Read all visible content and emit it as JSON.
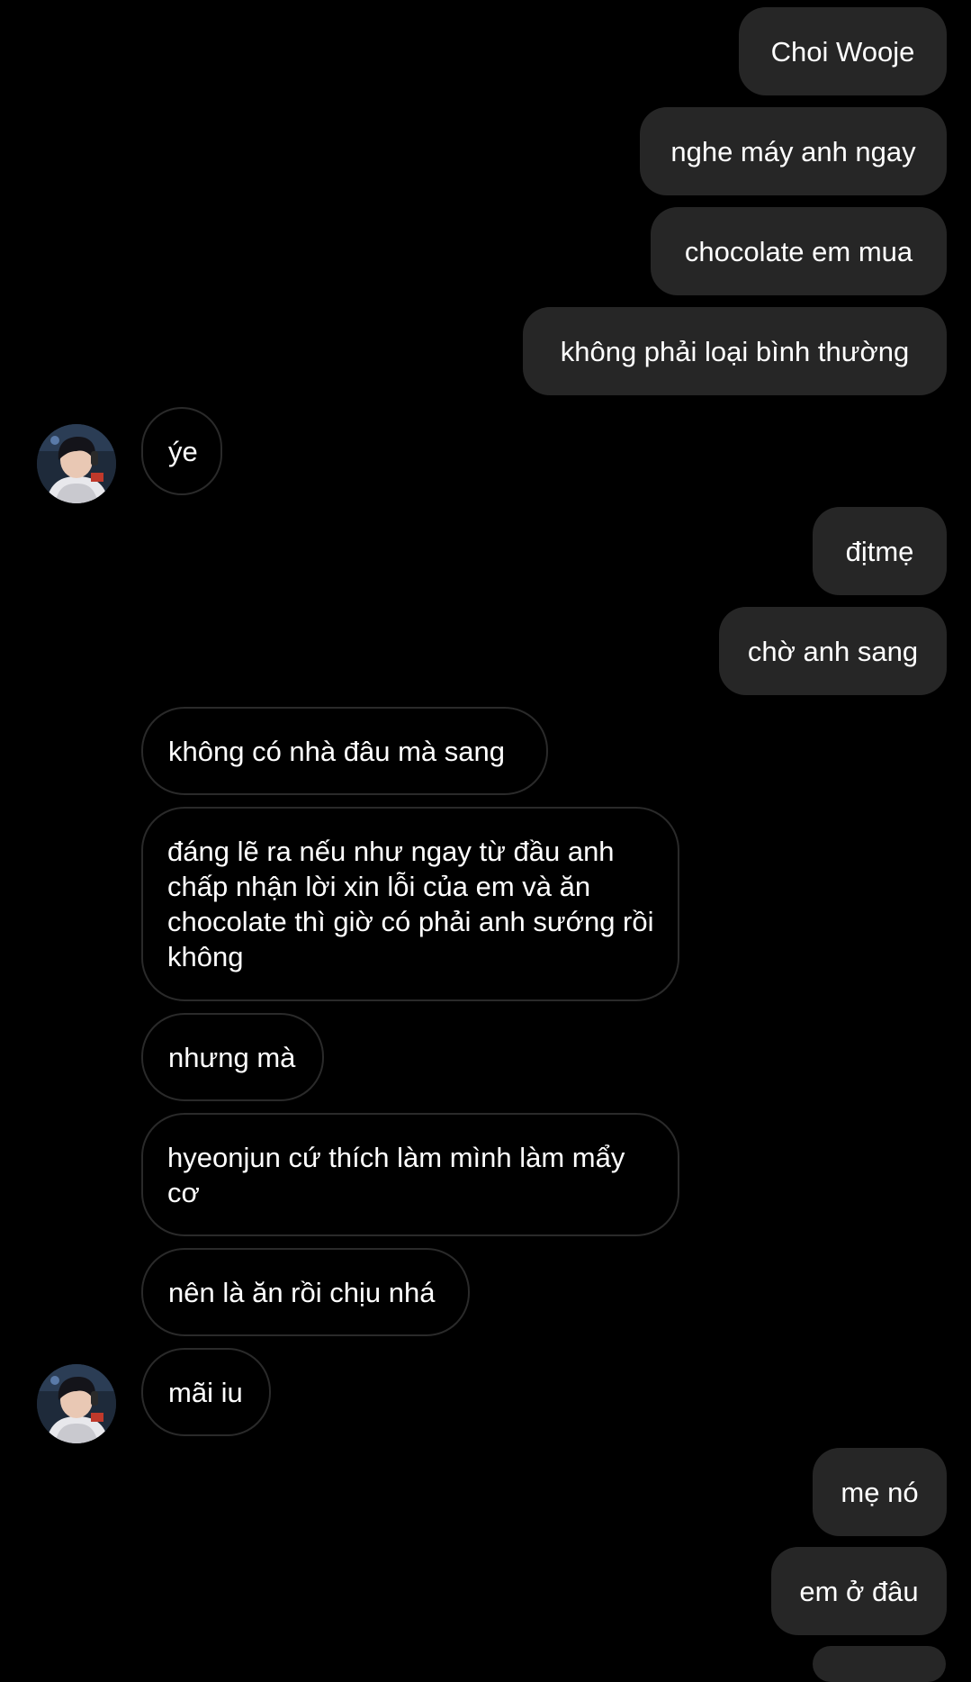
{
  "colors": {
    "background": "#000000",
    "sent_bubble": "#262626",
    "received_border": "#2a2a2a",
    "text": "#ffffff"
  },
  "avatar_icon": "profile-photo-avatar",
  "messages": [
    {
      "direction": "sent",
      "text": "Choi Wooje"
    },
    {
      "direction": "sent",
      "text": "nghe máy anh ngay"
    },
    {
      "direction": "sent",
      "text": "chocolate em mua"
    },
    {
      "direction": "sent",
      "text": "không phải loại bình thường"
    },
    {
      "direction": "received",
      "text": "ýe"
    },
    {
      "direction": "sent",
      "text": "địtmẹ"
    },
    {
      "direction": "sent",
      "text": "chờ anh sang"
    },
    {
      "direction": "received",
      "text": "không có nhà đâu mà sang"
    },
    {
      "direction": "received",
      "text": "đáng lẽ ra nếu như ngay từ đầu anh chấp nhận lời xin lỗi của em và ăn chocolate thì giờ có phải anh sướng rồi không"
    },
    {
      "direction": "received",
      "text": "nhưng mà"
    },
    {
      "direction": "received",
      "text": "hyeonjun cứ thích làm mình làm mẩy cơ"
    },
    {
      "direction": "received",
      "text": "nên là ăn rồi chịu nhá"
    },
    {
      "direction": "received",
      "text": "mãi iu"
    },
    {
      "direction": "sent",
      "text": "mẹ nó"
    },
    {
      "direction": "sent",
      "text": "em ở đâu"
    }
  ]
}
